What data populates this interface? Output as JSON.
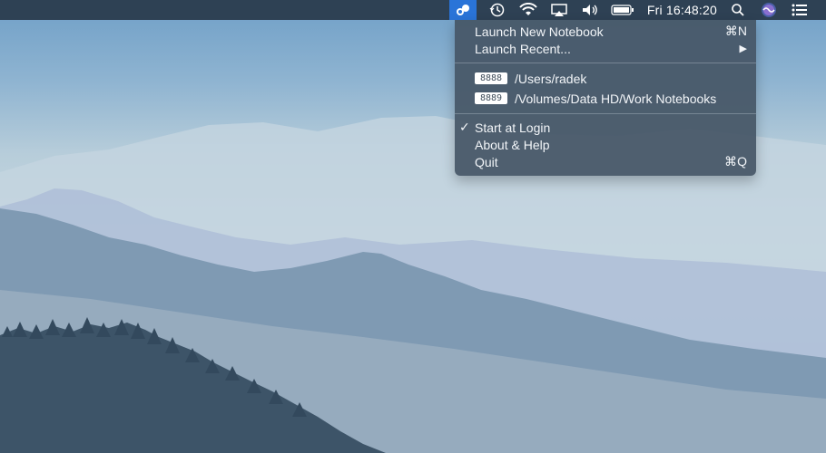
{
  "menubar": {
    "clock": "Fri 16:48:20",
    "icons": [
      "jupyter-app-icon",
      "time-machine-icon",
      "wifi-icon",
      "airplay-icon",
      "volume-icon",
      "battery-icon",
      "spotlight-search-icon",
      "siri-icon",
      "notification-center-icon"
    ]
  },
  "menu": {
    "launch_new": {
      "label": "Launch New Notebook",
      "shortcut": "⌘N"
    },
    "launch_recent": {
      "label": "Launch Recent...",
      "arrow": "▶"
    },
    "servers": [
      {
        "port": "8888",
        "path": "/Users/radek"
      },
      {
        "port": "8889",
        "path": "/Volumes/Data HD/Work Notebooks"
      }
    ],
    "start_at_login": {
      "label": "Start at Login",
      "check": "✓"
    },
    "about": {
      "label": "About & Help"
    },
    "quit": {
      "label": "Quit",
      "shortcut": "⌘Q"
    }
  },
  "colors": {
    "menubar_bg": "#28384a",
    "app_highlight": "#2a74d8",
    "menu_bg": "#465666",
    "menu_text": "#f2f5f8"
  }
}
